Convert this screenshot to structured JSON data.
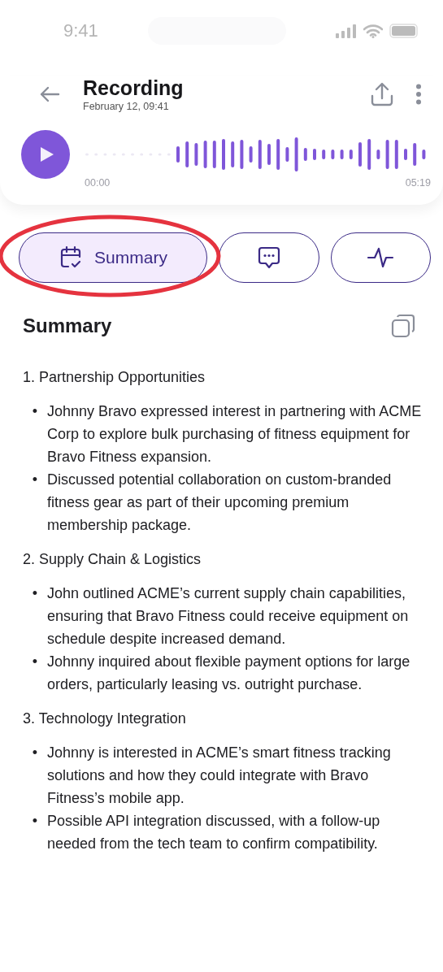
{
  "status_bar": {
    "time": "9:41"
  },
  "header": {
    "title": "Recording",
    "subtitle": "February 12, 09:41"
  },
  "player": {
    "start_time": "00:00",
    "end_time": "05:19"
  },
  "tabs": [
    {
      "kind": "summary",
      "label": "Summary",
      "selected": true
    },
    {
      "kind": "chat",
      "selected": false
    },
    {
      "kind": "activity",
      "selected": false
    }
  ],
  "summary": {
    "title": "Summary",
    "marker": "•",
    "sections": [
      {
        "heading": "1. Partnership Opportunities",
        "bullets": [
          "Johnny Bravo expressed interest in partnering with ACME Corp to explore bulk purchasing of fitness equipment for Bravo Fitness expansion.",
          "Discussed potential collaboration on custom-branded fitness gear as part of their upcoming premium membership package."
        ]
      },
      {
        "heading": "2. Supply Chain & Logistics",
        "bullets": [
          "John outlined ACME’s current supply chain capabilities, ensuring that Bravo Fitness could receive equipment on schedule despite increased demand.",
          "Johnny inquired about flexible payment options for large orders, particularly leasing vs. outright purchase."
        ]
      },
      {
        "heading": "3. Technology Integration",
        "bullets": [
          "Johnny is interested in ACME’s smart fitness tracking solutions and how they could integrate with Bravo Fitness’s mobile app.",
          "Possible API integration discussed, with a follow-up needed from the tech team to confirm compatibility."
        ]
      }
    ]
  }
}
